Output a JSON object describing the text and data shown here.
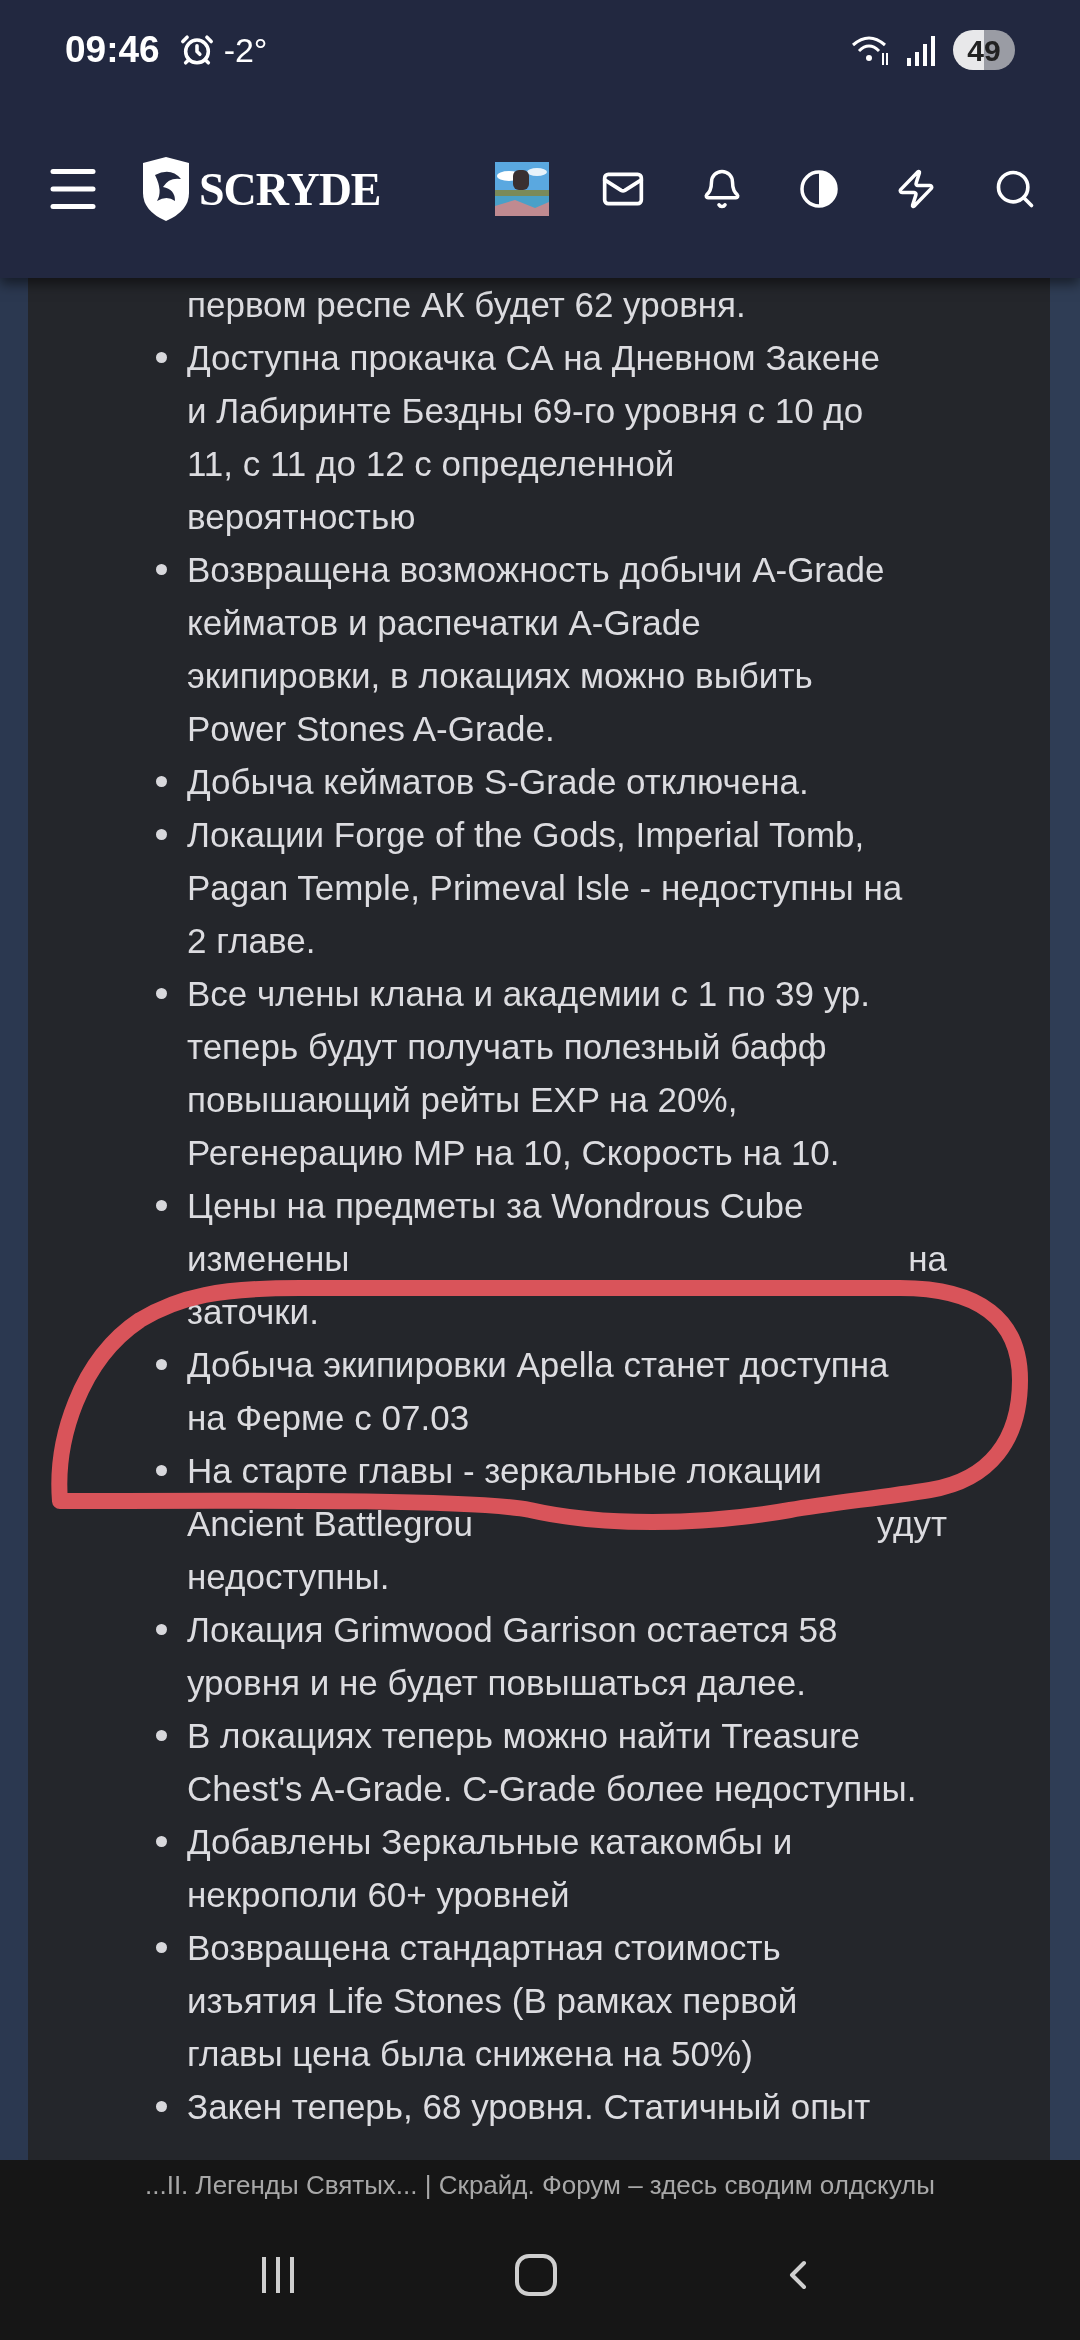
{
  "status_bar": {
    "time": "09:46",
    "temperature": "-2°",
    "battery": "49"
  },
  "header": {
    "logo": "SCRYDE"
  },
  "items": [
    {
      "lines": [
        "первом респе АК будет 62 уровня."
      ],
      "bullet": false
    },
    {
      "lines": [
        "Доступна прокачка СА на Дневном Закене",
        "и Лабиринте Бездны 69-го уровня с 10 до",
        "11, с 11 до 12 с определенной",
        "вероятностью"
      ],
      "bullet": true
    },
    {
      "lines": [
        "Возвращена возможность добычи A-Grade",
        "кейматов и распечатки A-Grade",
        "экипировки, в локациях можно выбить",
        "Power Stones A-Grade."
      ],
      "bullet": true
    },
    {
      "lines": [
        "Добыча кейматов S-Grade отключена."
      ],
      "bullet": true
    },
    {
      "lines": [
        "Локации Forge of the Gods, Imperial Tomb,",
        "Pagan Temple, Primeval Isle - недоступны на",
        "2 главе."
      ],
      "bullet": true
    },
    {
      "lines": [
        "Все члены клана и академии с 1 по 39 ур.",
        "теперь будут получать полезный бафф",
        "повышающий рейты EXP на 20%,",
        "Регенерацию MP на 10, Скорость на 10."
      ],
      "bullet": true
    },
    {
      "lines": [
        "Цены на предметы за Wondrous Cube",
        [
          "изменены",
          "на"
        ],
        "заточки."
      ],
      "bullet": true
    },
    {
      "lines": [
        "Добыча экипировки Apella станет доступна",
        "на Ферме с 07.03"
      ],
      "bullet": true
    },
    {
      "lines": [
        "На старте главы - зеркальные локации",
        [
          "Ancient Battlegrou",
          "удут"
        ],
        "недоступны."
      ],
      "bullet": true
    },
    {
      "lines": [
        "Локация Grimwood Garrison остается 58",
        "уровня и не будет повышаться далее."
      ],
      "bullet": true
    },
    {
      "lines": [
        "В локациях теперь можно найти Treasure",
        "Chest's A-Grade. C-Grade более недоступны."
      ],
      "bullet": true
    },
    {
      "lines": [
        "Добавлены Зеркальные катакомбы и",
        "некрополи 60+ уровней"
      ],
      "bullet": true
    },
    {
      "lines": [
        "Возвращена стандартная стоимость",
        "изъятия Life Stones (В рамках первой",
        "главы цена была снижена на 50%)"
      ],
      "bullet": true
    },
    {
      "lines": [
        "Закен теперь, 68 уровня. Статичный опыт"
      ],
      "bullet": true
    }
  ],
  "page_title": "...II. Легенды Святых... | Скрайд. Форум – здесь сводим олдскулы"
}
